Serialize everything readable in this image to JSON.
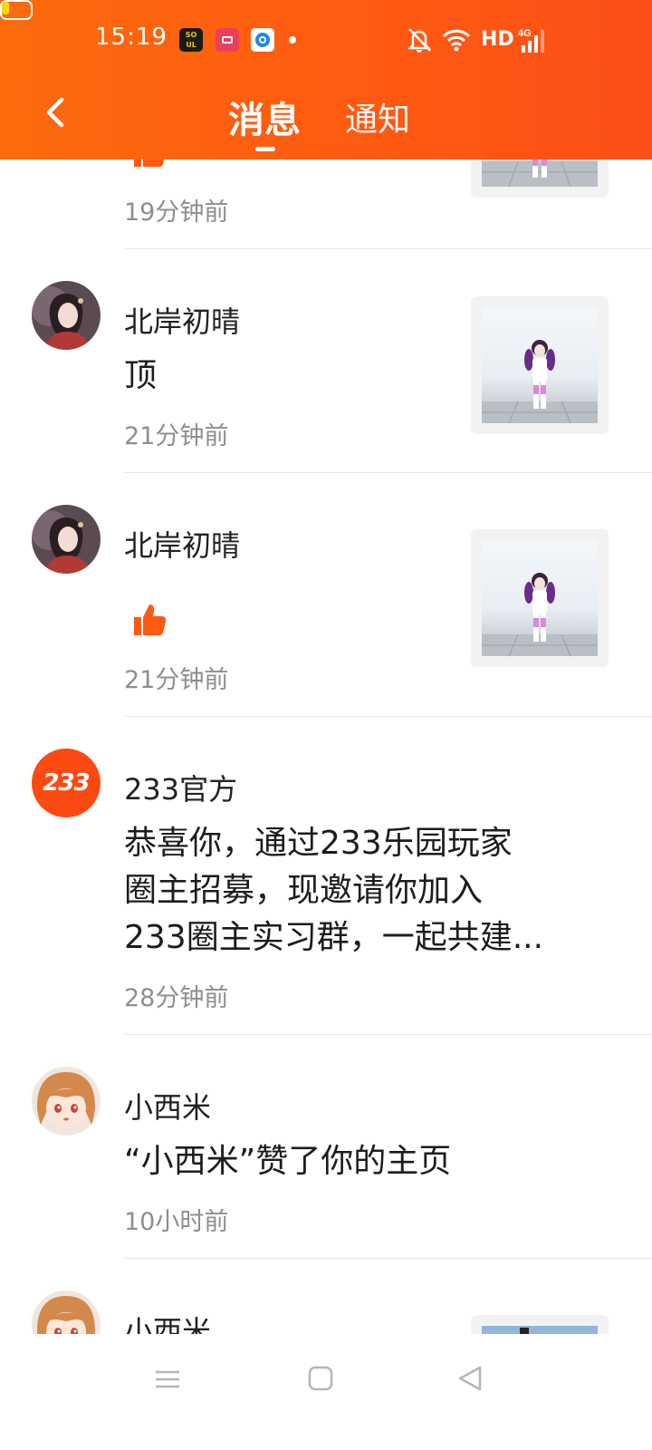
{
  "status_bar": {
    "time": "15:19",
    "soul_app_text": "SO UL",
    "network": "HD",
    "cell": "4G"
  },
  "nav": {
    "tabs": [
      {
        "label": "消息",
        "active": true
      },
      {
        "label": "通知",
        "active": false
      }
    ]
  },
  "messages": [
    {
      "name": "",
      "content": "like",
      "time": "19分钟前",
      "has_thumb": true
    },
    {
      "name": "北岸初晴",
      "content": "顶",
      "time": "21分钟前",
      "has_thumb": true
    },
    {
      "name": "北岸初晴",
      "content": "like",
      "time": "21分钟前",
      "has_thumb": true
    },
    {
      "name": "233官方",
      "avatar_text": "233",
      "content_lines": [
        "恭喜你，通过233乐园玩家",
        "圈主招募，现邀请你加入",
        "233圈主实习群，一起共建..."
      ],
      "time": "28分钟前",
      "has_thumb": false
    },
    {
      "name": "小西米",
      "content": "“小西米”赞了你的主页",
      "time": "10小时前",
      "has_thumb": false
    },
    {
      "name": "小西米",
      "content": "",
      "time": "",
      "has_thumb": true
    }
  ],
  "colors": {
    "header_start": "#fb6b0c",
    "header_end": "#fc4f17",
    "like": "#ff5a12",
    "official_avatar": "#fb4a12"
  }
}
